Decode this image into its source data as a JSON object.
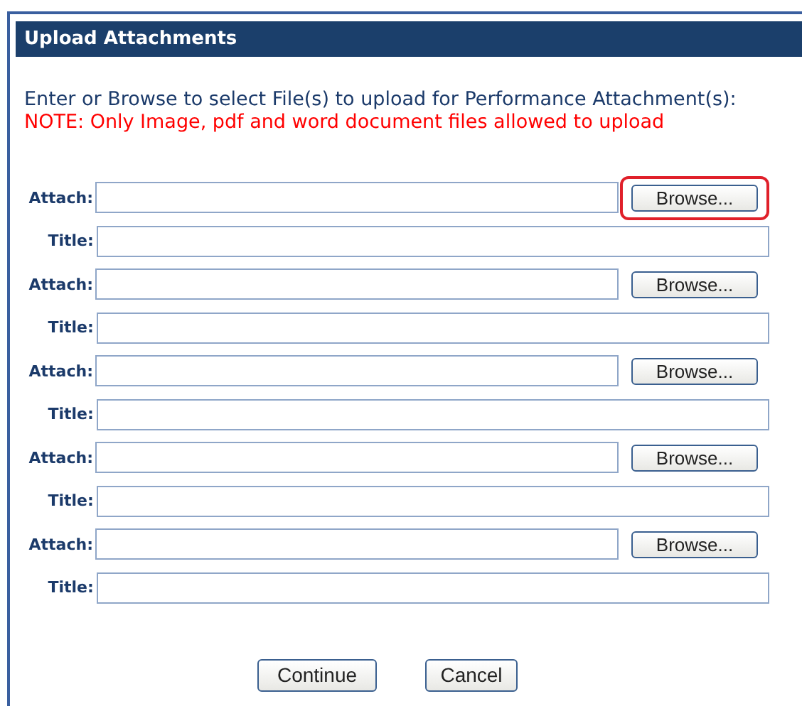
{
  "window": {
    "title": "Upload Attachments"
  },
  "instructions": "Enter or Browse to select File(s) to upload for Performance Attachment(s):",
  "note": "NOTE: Only Image, pdf and word document files allowed to upload",
  "attachments": [
    {
      "attach_label": "Attach:",
      "browse_button": "Browse...",
      "highlighted": true,
      "title_label": "Title:"
    },
    {
      "attach_label": "Attach:",
      "browse_button": "Browse...",
      "highlighted": false,
      "title_label": "Title:"
    },
    {
      "attach_label": "Attach:",
      "browse_button": "Browse...",
      "highlighted": false,
      "title_label": "Title:"
    },
    {
      "attach_label": "Attach:",
      "browse_button": "Browse...",
      "highlighted": false,
      "title_label": "Title:"
    },
    {
      "attach_label": "Attach:",
      "browse_button": "Browse...",
      "highlighted": false,
      "title_label": "Title:"
    }
  ],
  "buttons": [
    "Continue",
    "Cancel"
  ]
}
